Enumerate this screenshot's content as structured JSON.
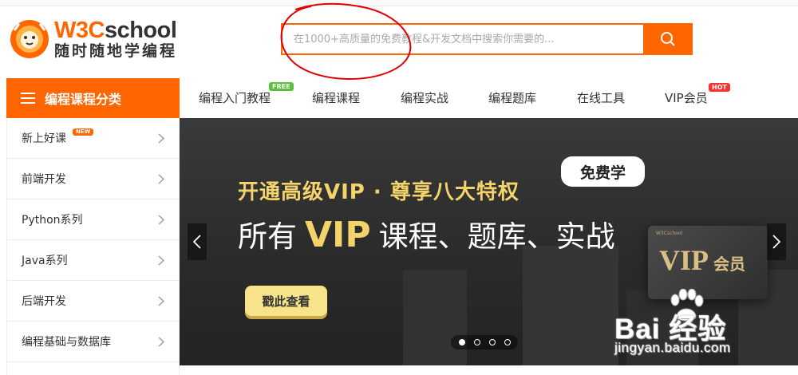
{
  "logo": {
    "prefix": "W3C",
    "suffix": "school",
    "tagline": "随时随地学编程"
  },
  "search": {
    "placeholder": "在1000+高质量的免费教程&开发文档中搜索你需要的...",
    "button_icon": "search-icon"
  },
  "category_button": {
    "label": "编程课程分类",
    "icon": "menu-icon"
  },
  "nav": {
    "items": [
      {
        "label": "编程入门教程",
        "badge": "FREE"
      },
      {
        "label": "编程课程"
      },
      {
        "label": "编程实战"
      },
      {
        "label": "编程题库"
      },
      {
        "label": "在线工具"
      },
      {
        "label": "VIP会员",
        "badge": "HOT"
      }
    ]
  },
  "sidebar": {
    "items": [
      {
        "label": "新上好课",
        "badge": "NEW"
      },
      {
        "label": "前端开发"
      },
      {
        "label": "Python系列"
      },
      {
        "label": "Java系列"
      },
      {
        "label": "后端开发"
      },
      {
        "label": "编程基础与数据库"
      }
    ]
  },
  "banner": {
    "headline": "开通高级VIP · 尊享八大特权",
    "sub_prefix": "所有",
    "sub_vip": "VIP",
    "sub_suffix": "课程、题库、实战",
    "cta": "戳此查看",
    "free_tag": "免费学",
    "card_brand": "W3Cschool",
    "card_vip": "VIP",
    "card_member": "会员",
    "slide_count": 4,
    "active_slide": 1
  },
  "watermark": {
    "brand": "Bai  经验",
    "url": "jingyan.baidu.com"
  },
  "colors": {
    "accent": "#ff6600",
    "gold": "#f5d36b",
    "annotation": "#e00000"
  }
}
